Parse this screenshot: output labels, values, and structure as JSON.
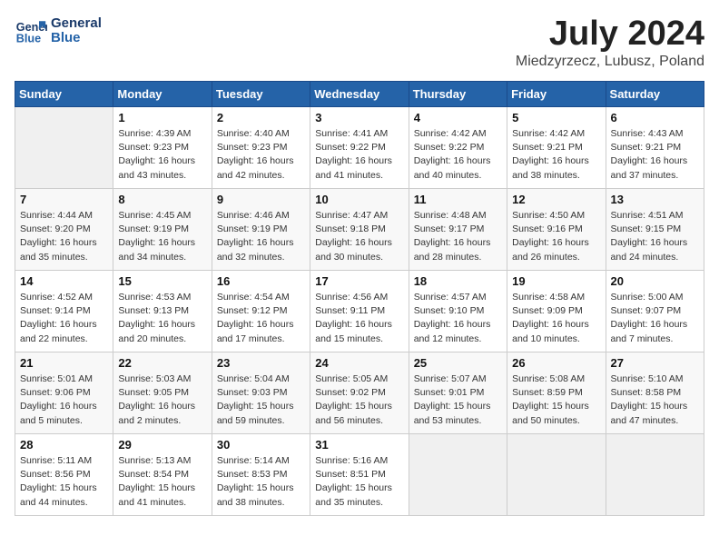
{
  "logo": {
    "line1": "General",
    "line2": "Blue"
  },
  "title": "July 2024",
  "location": "Miedzyrzecz, Lubusz, Poland",
  "headers": [
    "Sunday",
    "Monday",
    "Tuesday",
    "Wednesday",
    "Thursday",
    "Friday",
    "Saturday"
  ],
  "weeks": [
    [
      {
        "day": "",
        "sunrise": "",
        "sunset": "",
        "daylight": ""
      },
      {
        "day": "1",
        "sunrise": "Sunrise: 4:39 AM",
        "sunset": "Sunset: 9:23 PM",
        "daylight": "Daylight: 16 hours and 43 minutes."
      },
      {
        "day": "2",
        "sunrise": "Sunrise: 4:40 AM",
        "sunset": "Sunset: 9:23 PM",
        "daylight": "Daylight: 16 hours and 42 minutes."
      },
      {
        "day": "3",
        "sunrise": "Sunrise: 4:41 AM",
        "sunset": "Sunset: 9:22 PM",
        "daylight": "Daylight: 16 hours and 41 minutes."
      },
      {
        "day": "4",
        "sunrise": "Sunrise: 4:42 AM",
        "sunset": "Sunset: 9:22 PM",
        "daylight": "Daylight: 16 hours and 40 minutes."
      },
      {
        "day": "5",
        "sunrise": "Sunrise: 4:42 AM",
        "sunset": "Sunset: 9:21 PM",
        "daylight": "Daylight: 16 hours and 38 minutes."
      },
      {
        "day": "6",
        "sunrise": "Sunrise: 4:43 AM",
        "sunset": "Sunset: 9:21 PM",
        "daylight": "Daylight: 16 hours and 37 minutes."
      }
    ],
    [
      {
        "day": "7",
        "sunrise": "Sunrise: 4:44 AM",
        "sunset": "Sunset: 9:20 PM",
        "daylight": "Daylight: 16 hours and 35 minutes."
      },
      {
        "day": "8",
        "sunrise": "Sunrise: 4:45 AM",
        "sunset": "Sunset: 9:19 PM",
        "daylight": "Daylight: 16 hours and 34 minutes."
      },
      {
        "day": "9",
        "sunrise": "Sunrise: 4:46 AM",
        "sunset": "Sunset: 9:19 PM",
        "daylight": "Daylight: 16 hours and 32 minutes."
      },
      {
        "day": "10",
        "sunrise": "Sunrise: 4:47 AM",
        "sunset": "Sunset: 9:18 PM",
        "daylight": "Daylight: 16 hours and 30 minutes."
      },
      {
        "day": "11",
        "sunrise": "Sunrise: 4:48 AM",
        "sunset": "Sunset: 9:17 PM",
        "daylight": "Daylight: 16 hours and 28 minutes."
      },
      {
        "day": "12",
        "sunrise": "Sunrise: 4:50 AM",
        "sunset": "Sunset: 9:16 PM",
        "daylight": "Daylight: 16 hours and 26 minutes."
      },
      {
        "day": "13",
        "sunrise": "Sunrise: 4:51 AM",
        "sunset": "Sunset: 9:15 PM",
        "daylight": "Daylight: 16 hours and 24 minutes."
      }
    ],
    [
      {
        "day": "14",
        "sunrise": "Sunrise: 4:52 AM",
        "sunset": "Sunset: 9:14 PM",
        "daylight": "Daylight: 16 hours and 22 minutes."
      },
      {
        "day": "15",
        "sunrise": "Sunrise: 4:53 AM",
        "sunset": "Sunset: 9:13 PM",
        "daylight": "Daylight: 16 hours and 20 minutes."
      },
      {
        "day": "16",
        "sunrise": "Sunrise: 4:54 AM",
        "sunset": "Sunset: 9:12 PM",
        "daylight": "Daylight: 16 hours and 17 minutes."
      },
      {
        "day": "17",
        "sunrise": "Sunrise: 4:56 AM",
        "sunset": "Sunset: 9:11 PM",
        "daylight": "Daylight: 16 hours and 15 minutes."
      },
      {
        "day": "18",
        "sunrise": "Sunrise: 4:57 AM",
        "sunset": "Sunset: 9:10 PM",
        "daylight": "Daylight: 16 hours and 12 minutes."
      },
      {
        "day": "19",
        "sunrise": "Sunrise: 4:58 AM",
        "sunset": "Sunset: 9:09 PM",
        "daylight": "Daylight: 16 hours and 10 minutes."
      },
      {
        "day": "20",
        "sunrise": "Sunrise: 5:00 AM",
        "sunset": "Sunset: 9:07 PM",
        "daylight": "Daylight: 16 hours and 7 minutes."
      }
    ],
    [
      {
        "day": "21",
        "sunrise": "Sunrise: 5:01 AM",
        "sunset": "Sunset: 9:06 PM",
        "daylight": "Daylight: 16 hours and 5 minutes."
      },
      {
        "day": "22",
        "sunrise": "Sunrise: 5:03 AM",
        "sunset": "Sunset: 9:05 PM",
        "daylight": "Daylight: 16 hours and 2 minutes."
      },
      {
        "day": "23",
        "sunrise": "Sunrise: 5:04 AM",
        "sunset": "Sunset: 9:03 PM",
        "daylight": "Daylight: 15 hours and 59 minutes."
      },
      {
        "day": "24",
        "sunrise": "Sunrise: 5:05 AM",
        "sunset": "Sunset: 9:02 PM",
        "daylight": "Daylight: 15 hours and 56 minutes."
      },
      {
        "day": "25",
        "sunrise": "Sunrise: 5:07 AM",
        "sunset": "Sunset: 9:01 PM",
        "daylight": "Daylight: 15 hours and 53 minutes."
      },
      {
        "day": "26",
        "sunrise": "Sunrise: 5:08 AM",
        "sunset": "Sunset: 8:59 PM",
        "daylight": "Daylight: 15 hours and 50 minutes."
      },
      {
        "day": "27",
        "sunrise": "Sunrise: 5:10 AM",
        "sunset": "Sunset: 8:58 PM",
        "daylight": "Daylight: 15 hours and 47 minutes."
      }
    ],
    [
      {
        "day": "28",
        "sunrise": "Sunrise: 5:11 AM",
        "sunset": "Sunset: 8:56 PM",
        "daylight": "Daylight: 15 hours and 44 minutes."
      },
      {
        "day": "29",
        "sunrise": "Sunrise: 5:13 AM",
        "sunset": "Sunset: 8:54 PM",
        "daylight": "Daylight: 15 hours and 41 minutes."
      },
      {
        "day": "30",
        "sunrise": "Sunrise: 5:14 AM",
        "sunset": "Sunset: 8:53 PM",
        "daylight": "Daylight: 15 hours and 38 minutes."
      },
      {
        "day": "31",
        "sunrise": "Sunrise: 5:16 AM",
        "sunset": "Sunset: 8:51 PM",
        "daylight": "Daylight: 15 hours and 35 minutes."
      },
      {
        "day": "",
        "sunrise": "",
        "sunset": "",
        "daylight": ""
      },
      {
        "day": "",
        "sunrise": "",
        "sunset": "",
        "daylight": ""
      },
      {
        "day": "",
        "sunrise": "",
        "sunset": "",
        "daylight": ""
      }
    ]
  ]
}
